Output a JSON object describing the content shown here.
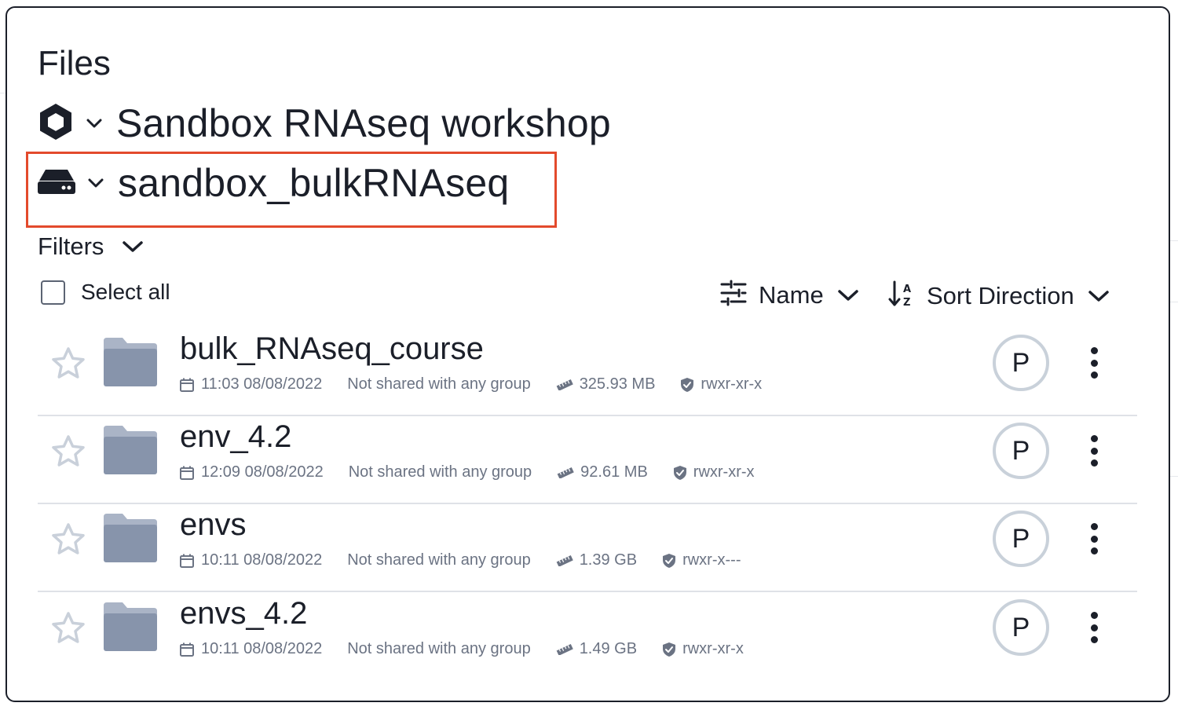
{
  "page": {
    "title": "Files"
  },
  "breadcrumb": {
    "project": {
      "label": "Sandbox RNAseq workshop",
      "icon": "hexagon-icon"
    },
    "storage": {
      "label": "sandbox_bulkRNAseq",
      "icon": "drive-icon"
    }
  },
  "highlight_color": "#e34a2c",
  "filters": {
    "label": "Filters"
  },
  "select_all": {
    "label": "Select all"
  },
  "sort": {
    "field_label": "Name",
    "direction_label": "Sort Direction"
  },
  "files": [
    {
      "name": "bulk_RNAseq_course",
      "modified": "11:03 08/08/2022",
      "sharing": "Not shared with any group",
      "size": "325.93 MB",
      "permissions": "rwxr-xr-x",
      "owner_initial": "P"
    },
    {
      "name": "env_4.2",
      "modified": "12:09 08/08/2022",
      "sharing": "Not shared with any group",
      "size": "92.61 MB",
      "permissions": "rwxr-xr-x",
      "owner_initial": "P"
    },
    {
      "name": "envs",
      "modified": "10:11 08/08/2022",
      "sharing": "Not shared with any group",
      "size": "1.39 GB",
      "permissions": "rwxr-x---",
      "owner_initial": "P"
    },
    {
      "name": "envs_4.2",
      "modified": "10:11 08/08/2022",
      "sharing": "Not shared with any group",
      "size": "1.49 GB",
      "permissions": "rwxr-xr-x",
      "owner_initial": "P"
    }
  ],
  "colors": {
    "text": "#1b1f29",
    "muted": "#6b7383",
    "folder": "#8794ab",
    "star": "#c9d0da",
    "avatar_border": "#c9d1da"
  }
}
